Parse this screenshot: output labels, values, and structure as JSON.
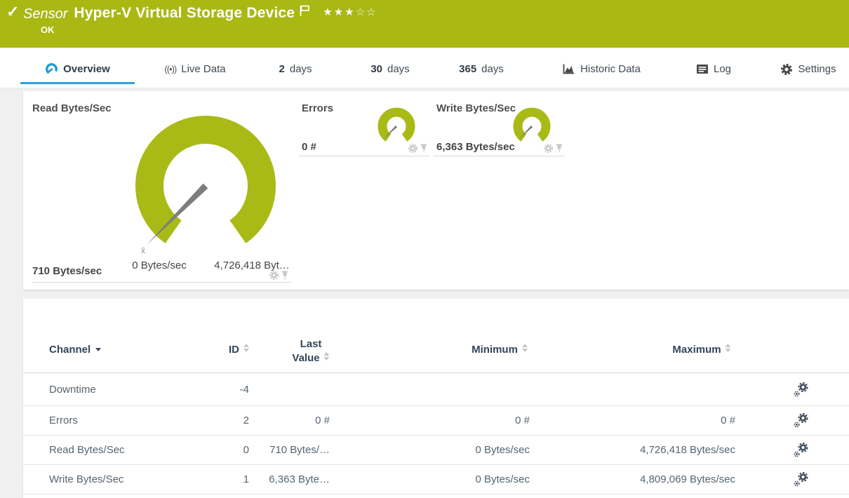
{
  "header": {
    "status_icon": "✓",
    "kind_label": "Sensor",
    "title": "Hyper-V Virtual Storage Device",
    "status": "OK",
    "stars": "★★★☆☆"
  },
  "tabs": {
    "overview": {
      "label": "Overview",
      "active": true
    },
    "live_data": {
      "label": "Live Data",
      "icon_text": "((•))"
    },
    "days2": {
      "num": "2",
      "label": "days"
    },
    "days30": {
      "num": "30",
      "label": "days"
    },
    "days365": {
      "num": "365",
      "label": "days"
    },
    "historic": {
      "label": "Historic Data"
    },
    "log": {
      "label": "Log"
    },
    "settings": {
      "label": "Settings"
    }
  },
  "gauges": {
    "read": {
      "title": "Read Bytes/Sec",
      "value": "710 Bytes/sec",
      "min_label": "0 Bytes/sec",
      "max_label": "4,726,418 Byt…",
      "mean_marker": "x̄"
    },
    "errors": {
      "title": "Errors",
      "value": "0 #"
    },
    "write": {
      "title": "Write Bytes/Sec",
      "value": "6,363 Bytes/sec"
    }
  },
  "table": {
    "header": {
      "channel": "Channel",
      "id": "ID",
      "last1": "Last",
      "last2": "Value",
      "min": "Minimum",
      "max": "Maximum"
    },
    "rows": [
      {
        "channel": "Downtime",
        "id": "-4",
        "last": "",
        "min": "",
        "max": ""
      },
      {
        "channel": "Errors",
        "id": "2",
        "last": "0 #",
        "min": "0 #",
        "max": "0 #"
      },
      {
        "channel": "Read Bytes/Sec",
        "id": "0",
        "last": "710 Bytes/…",
        "min": "0 Bytes/sec",
        "max": "4,726,418 Bytes/sec"
      },
      {
        "channel": "Write Bytes/Sec",
        "id": "1",
        "last": "6,363 Byte…",
        "min": "0 Bytes/sec",
        "max": "4,809,069 Bytes/sec"
      }
    ]
  },
  "colors": {
    "header_green": "#a9b813",
    "gauge_green": "#a9ba17",
    "needle_gray": "#7d7d7d",
    "active_tab_blue": "#2aa3dc",
    "overview_icon_blue": "#1f9cd7"
  }
}
